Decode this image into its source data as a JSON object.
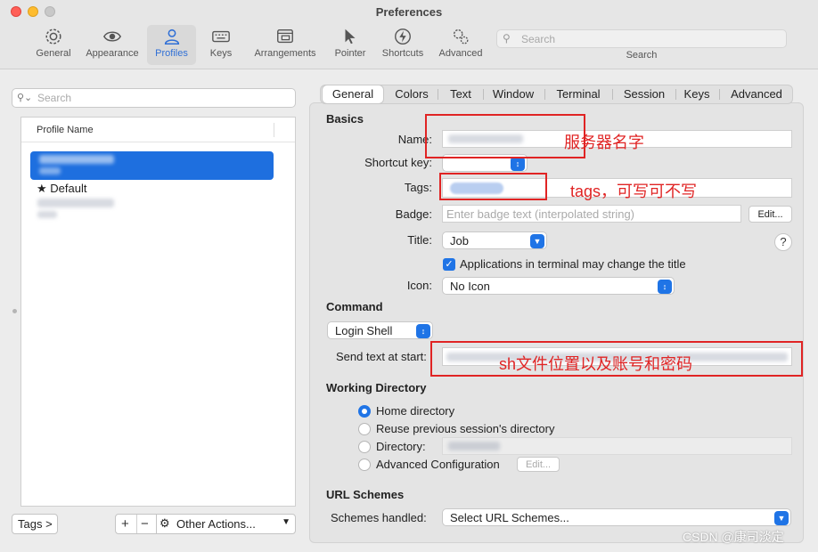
{
  "window": {
    "title": "Preferences"
  },
  "toolbar": {
    "items": [
      {
        "label": "General",
        "icon": "gear-icon"
      },
      {
        "label": "Appearance",
        "icon": "eye-icon"
      },
      {
        "label": "Profiles",
        "icon": "person-icon",
        "active": true
      },
      {
        "label": "Keys",
        "icon": "keyboard-icon"
      },
      {
        "label": "Arrangements",
        "icon": "window-icon"
      },
      {
        "label": "Pointer",
        "icon": "pointer-icon"
      },
      {
        "label": "Shortcuts",
        "icon": "lightning-icon"
      },
      {
        "label": "Advanced",
        "icon": "gears-icon"
      }
    ],
    "search_placeholder": "Search",
    "search_label": "Search",
    "active_color": "#2f6fd6"
  },
  "sidebar": {
    "search_placeholder": "Search",
    "column_header": "Profile Name",
    "default_profile": "★ Default",
    "tags_button": "Tags >",
    "add_label": "+",
    "remove_label": "−",
    "other_actions": "Other Actions...",
    "selection_color": "#1e6fdf"
  },
  "tabs": [
    "General",
    "Colors",
    "Text",
    "Window",
    "Terminal",
    "Session",
    "Keys",
    "Advanced"
  ],
  "basics": {
    "heading": "Basics",
    "name_label": "Name:",
    "shortcut_label": "Shortcut key:",
    "tags_label": "Tags:",
    "badge_label": "Badge:",
    "badge_placeholder": "Enter badge text (interpolated string)",
    "badge_edit": "Edit...",
    "title_label": "Title:",
    "title_value": "Job",
    "title_checkbox": "Applications in terminal may change the title",
    "icon_label": "Icon:",
    "icon_value": "No Icon"
  },
  "command": {
    "heading": "Command",
    "shell_value": "Login Shell",
    "send_text_label": "Send text at start:"
  },
  "working_directory": {
    "heading": "Working Directory",
    "options": [
      "Home directory",
      "Reuse previous session's directory",
      "Directory:",
      "Advanced Configuration"
    ],
    "edit_button": "Edit..."
  },
  "url_schemes": {
    "heading": "URL Schemes",
    "handled_label": "Schemes handled:",
    "handled_value": "Select URL Schemes..."
  },
  "annotations": {
    "name_note": "服务器名字",
    "tags_note": "tags，可写可不写",
    "send_text_note": "sh文件位置以及账号和密码",
    "color": "#e02424"
  },
  "watermark": "CSDN @康司淡定"
}
